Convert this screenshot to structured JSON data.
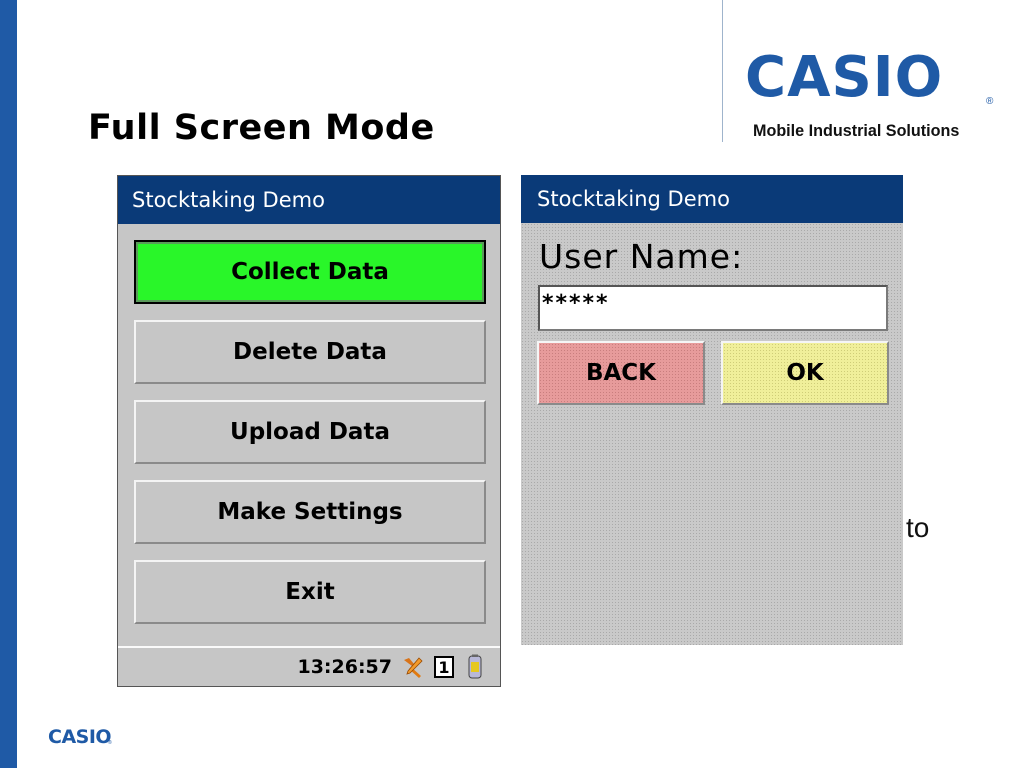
{
  "slide": {
    "title": "Full Screen Mode",
    "stray_text": "to"
  },
  "brand": {
    "logo_text": "CASIO",
    "registered_mark": "®",
    "tagline": "Mobile Industrial Solutions",
    "footer_logo_text": "CASIO",
    "color": "#1f5aa6"
  },
  "screen_main": {
    "title": "Stocktaking Demo",
    "title_color": "#0a3a78",
    "menu": [
      {
        "label": "Collect Data",
        "selected": true,
        "color": "#29f629"
      },
      {
        "label": "Delete Data",
        "selected": false
      },
      {
        "label": "Upload Data",
        "selected": false
      },
      {
        "label": "Make Settings",
        "selected": false
      },
      {
        "label": "Exit",
        "selected": false
      }
    ],
    "status": {
      "time": "13:26:57",
      "tray_icons": [
        "tools-icon",
        "input-mode-icon",
        "battery-icon"
      ],
      "input_mode": "1"
    }
  },
  "screen_login": {
    "title": "Stocktaking Demo",
    "field_label": "User Name:",
    "field_value": "*****",
    "buttons": {
      "back": {
        "label": "BACK",
        "color": "#e79b9b"
      },
      "ok": {
        "label": "OK",
        "color": "#f0ef9a"
      }
    }
  }
}
